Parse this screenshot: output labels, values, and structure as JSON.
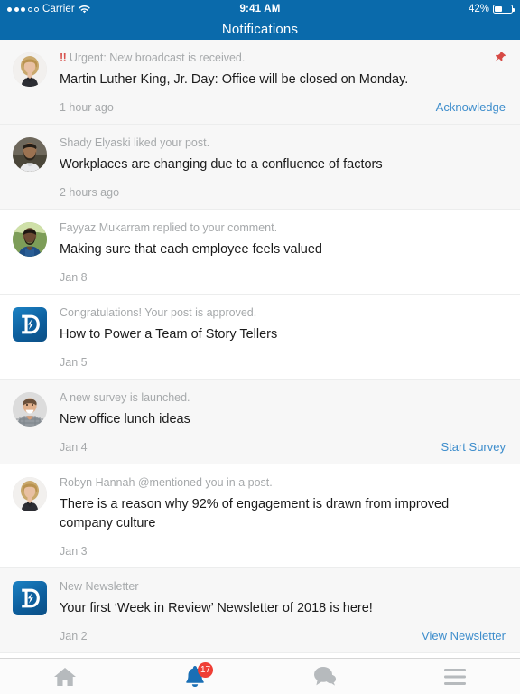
{
  "status_bar": {
    "carrier": "Carrier",
    "time": "9:41 AM",
    "battery": "42%",
    "signal_dots_filled": 3,
    "signal_dots_total": 5,
    "wifi_icon": "wifi-icon",
    "battery_icon": "battery-icon"
  },
  "header": {
    "title": "Notifications",
    "background": "#0a6aab"
  },
  "colors": {
    "accent": "#0a6aab",
    "link": "#3d8dcc",
    "urgent": "#d7534e",
    "badge": "#ef3e35",
    "row_tint": "#f7f7f7",
    "row_plain": "#ffffff"
  },
  "notifications": [
    {
      "avatar": "woman-blonde-avatar",
      "avatar_type": "photo",
      "avatar_variant": "woman-blonde",
      "urgent_marker": "!!",
      "meta": "Urgent: New broadcast is received.",
      "title": "Martin Luther King, Jr. Day: Office will be closed on Monday.",
      "time": "1 hour ago",
      "action": "Acknowledge",
      "pinned": true,
      "tint": true
    },
    {
      "avatar": "man-beard-avatar",
      "avatar_type": "photo",
      "avatar_variant": "man-beard",
      "urgent_marker": "",
      "meta": "Shady Elyaski liked your post.",
      "title": "Workplaces are changing due to a confluence of factors",
      "time": "2 hours ago",
      "action": "",
      "pinned": false,
      "tint": true
    },
    {
      "avatar": "man-blue-jacket-avatar",
      "avatar_type": "photo",
      "avatar_variant": "man-blue-jacket",
      "urgent_marker": "",
      "meta": "Fayyaz Mukarram replied to your comment.",
      "title": "Making sure that each employee feels valued",
      "time": "Jan 8",
      "action": "",
      "pinned": false,
      "tint": false
    },
    {
      "avatar": "dynamic-signal-logo",
      "avatar_type": "logo",
      "avatar_variant": "brand-d",
      "urgent_marker": "",
      "meta": "Congratulations! Your post is approved.",
      "title": "How to Power a Team of Story Tellers",
      "time": "Jan 5",
      "action": "",
      "pinned": false,
      "tint": false
    },
    {
      "avatar": "man-plaid-shirt-avatar",
      "avatar_type": "photo",
      "avatar_variant": "man-plaid",
      "urgent_marker": "",
      "meta": "A new survey is launched.",
      "title": "New office lunch ideas",
      "time": "Jan 4",
      "action": "Start Survey",
      "pinned": false,
      "tint": true
    },
    {
      "avatar": "woman-blonde-avatar",
      "avatar_type": "photo",
      "avatar_variant": "woman-blonde",
      "urgent_marker": "",
      "meta": "Robyn Hannah @mentioned you in a post.",
      "title": "There is a reason why 92% of engagement is drawn from improved company culture",
      "time": "Jan 3",
      "action": "",
      "pinned": false,
      "tint": false
    },
    {
      "avatar": "dynamic-signal-logo",
      "avatar_type": "logo",
      "avatar_variant": "brand-d",
      "urgent_marker": "",
      "meta": "New Newsletter",
      "title": "Your first ‘Week in Review’ Newsletter of 2018 is here!",
      "time": "Jan 2",
      "action": "View Newsletter",
      "pinned": false,
      "tint": true
    }
  ],
  "tabbar": {
    "items": [
      {
        "icon": "home-icon",
        "name": "tab-home",
        "active": false,
        "badge": ""
      },
      {
        "icon": "bell-icon",
        "name": "tab-notifications",
        "active": true,
        "badge": "17"
      },
      {
        "icon": "chat-icon",
        "name": "tab-messages",
        "active": false,
        "badge": ""
      },
      {
        "icon": "menu-icon",
        "name": "tab-more",
        "active": false,
        "badge": ""
      }
    ]
  }
}
